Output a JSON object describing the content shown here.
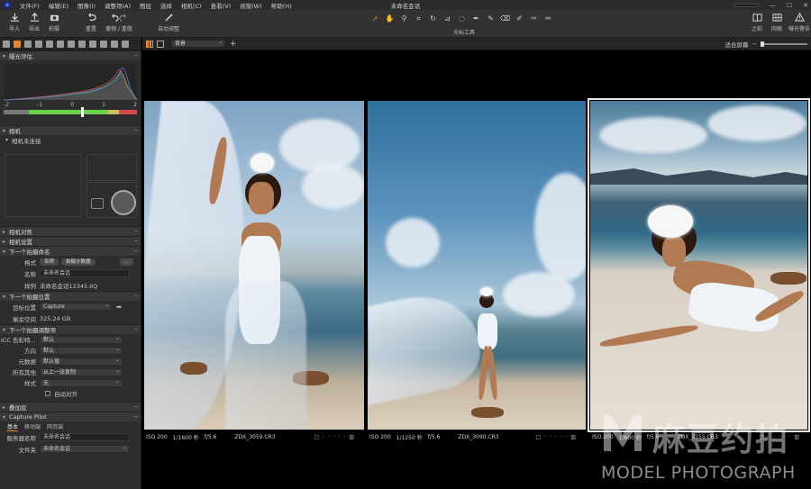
{
  "menubar": {
    "items": [
      "文件(F)",
      "编辑(E)",
      "图像(I)",
      "调整项(A)",
      "图层",
      "选择",
      "相机(C)",
      "查看(V)",
      "视窗(W)",
      "帮助(H)"
    ],
    "doc_title": "未命名会话",
    "win_minimize": "—",
    "win_maximize": "☐",
    "win_close": "✕"
  },
  "toolbar": {
    "import": "导入",
    "export": "导出",
    "capture": "拍摄",
    "reset": "重置",
    "undo_redo": "撤销 / 重做",
    "auto_adjust": "自动调整",
    "cursor_tools": "光标工具",
    "before": "之前",
    "grid": "网格",
    "exposure_warning": "曝光警告",
    "accent": "#e8862a"
  },
  "leftpanel": {
    "exposure": {
      "title": "曝光评估",
      "scale": [
        "-2",
        "-1",
        "0",
        "1",
        "2"
      ]
    },
    "camera": {
      "title": "相机",
      "status": "相机未连接"
    },
    "collapsed": [
      "相机对焦",
      "相机设置"
    ],
    "next_capture_naming": {
      "title": "下一个拍摄命名",
      "format_label": "格式",
      "format_pills": [
        "名称",
        "拍摄计数器"
      ],
      "more": "...",
      "name_label": "名称",
      "name_value": "未命名会话",
      "sample_label": "样例",
      "sample_value": "未命名会话12345.IIQ"
    },
    "next_capture_location": {
      "title": "下一个拍摄位置",
      "dest_label": "目标位置",
      "dest_value": "Capture",
      "free_label": "剩余空间",
      "free_value": "325.24 GB"
    },
    "next_capture_adjust": {
      "title": "下一个拍摄调整项",
      "rows": [
        {
          "label": "ICC 色彩特…",
          "value": "默认"
        },
        {
          "label": "方向",
          "value": "默认"
        },
        {
          "label": "元数据",
          "value": "默认值"
        },
        {
          "label": "所有其他",
          "value": "从上一张复制"
        },
        {
          "label": "样式",
          "value": "无"
        }
      ],
      "auto_align": "自动对齐"
    },
    "overlay": {
      "title": "叠加层"
    },
    "capture_pilot": {
      "title": "Capture Pilot",
      "tabs": [
        "基本",
        "移动端",
        "网页端"
      ],
      "server_label": "服务器名称",
      "server_value": "未命名会话",
      "folder_label": "文件夹",
      "folder_value": "未命名会话"
    }
  },
  "viewer": {
    "album_select": "背景",
    "add": "+",
    "fit_label": "适合屏幕",
    "photos": [
      {
        "iso": "ISO 200",
        "shutter": "1/1600 秒",
        "aperture": "f/5.6",
        "filename": "ZDX_3059.CR3"
      },
      {
        "iso": "ISO 200",
        "shutter": "1/1250 秒",
        "aperture": "f/5.6",
        "filename": "ZDX_3090.CR3"
      },
      {
        "iso": "ISO 200",
        "shutter": "1/800 秒",
        "aperture": "f/5.6",
        "filename": "ZDX_3155.CR3"
      }
    ],
    "caption_controls": "□ · · · · · ▥"
  },
  "watermark": {
    "cn": "麻豆约拍",
    "en": "MODEL PHOTOGRAPH"
  }
}
